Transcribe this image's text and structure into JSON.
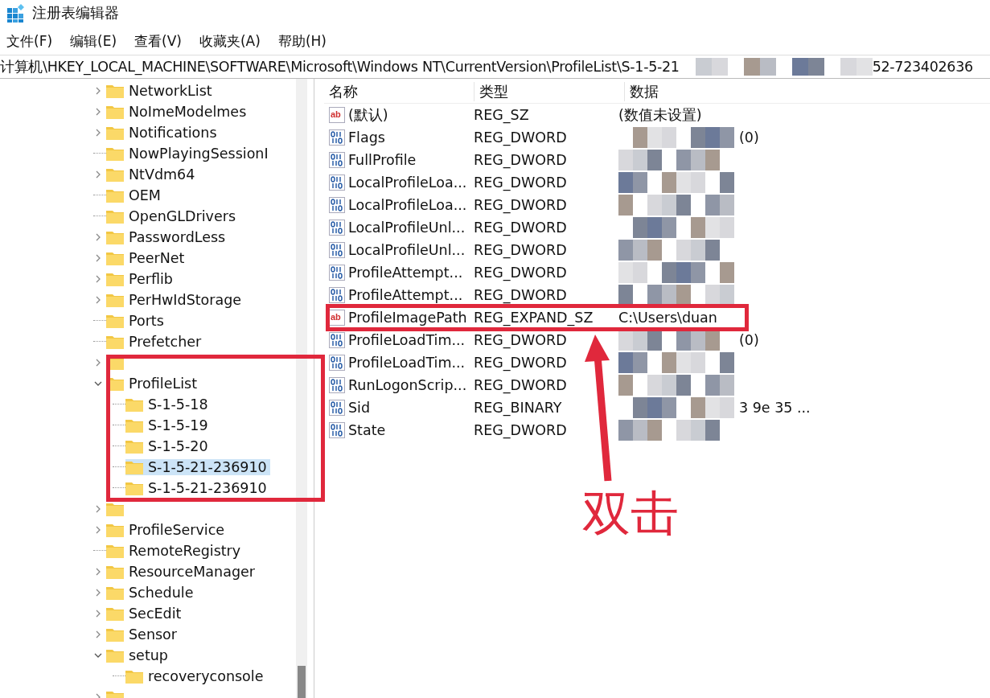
{
  "window": {
    "title": "注册表编辑器"
  },
  "menu": [
    "文件(F)",
    "编辑(E)",
    "查看(V)",
    "收藏夹(A)",
    "帮助(H)"
  ],
  "address": {
    "start": "计算机\\HKEY_LOCAL_MACHINE\\SOFTWARE\\Microsoft\\Windows NT\\CurrentVersion\\ProfileList\\S-1-5-21",
    "end": "52-723402636"
  },
  "tree": [
    {
      "label": "NetworkList",
      "kind": "branch",
      "expanded": false,
      "selected": false
    },
    {
      "label": "NoImeModelmes",
      "kind": "branch",
      "expanded": false,
      "selected": false
    },
    {
      "label": "Notifications",
      "kind": "branch",
      "expanded": false,
      "selected": false
    },
    {
      "label": "NowPlayingSessionI",
      "kind": "leaf",
      "selected": false
    },
    {
      "label": "NtVdm64",
      "kind": "branch",
      "expanded": false,
      "selected": false
    },
    {
      "label": "OEM",
      "kind": "leaf",
      "selected": false
    },
    {
      "label": "OpenGLDrivers",
      "kind": "leaf",
      "selected": false
    },
    {
      "label": "PasswordLess",
      "kind": "branch",
      "expanded": false,
      "selected": false
    },
    {
      "label": "PeerNet",
      "kind": "branch",
      "expanded": false,
      "selected": false
    },
    {
      "label": "Perflib",
      "kind": "branch",
      "expanded": false,
      "selected": false
    },
    {
      "label": "PerHwIdStorage",
      "kind": "branch",
      "expanded": false,
      "selected": false
    },
    {
      "label": "Ports",
      "kind": "leaf",
      "selected": false
    },
    {
      "label": "Prefetcher",
      "kind": "leaf",
      "selected": false
    },
    {
      "kind": "branch",
      "expanded": false,
      "selected": false
    },
    {
      "label": "ProfileList",
      "kind": "branch",
      "expanded": true,
      "selected": false,
      "children": [
        {
          "label": "S-1-5-18",
          "kind": "leaf",
          "selected": false
        },
        {
          "label": "S-1-5-19",
          "kind": "leaf",
          "selected": false
        },
        {
          "label": "S-1-5-20",
          "kind": "leaf",
          "selected": false
        },
        {
          "label": "S-1-5-21-236910",
          "kind": "leaf",
          "selected": true
        },
        {
          "label": "S-1-5-21-236910",
          "kind": "leaf",
          "selected": false
        }
      ]
    },
    {
      "kind": "branch",
      "expanded": false,
      "selected": false
    },
    {
      "label": "ProfileService",
      "kind": "branch",
      "expanded": false,
      "selected": false
    },
    {
      "label": "RemoteRegistry",
      "kind": "leaf",
      "selected": false
    },
    {
      "label": "ResourceManager",
      "kind": "branch",
      "expanded": false,
      "selected": false
    },
    {
      "label": "Schedule",
      "kind": "branch",
      "expanded": false,
      "selected": false
    },
    {
      "label": "SecEdit",
      "kind": "branch",
      "expanded": false,
      "selected": false
    },
    {
      "label": "Sensor",
      "kind": "branch",
      "expanded": false,
      "selected": false
    },
    {
      "label": "setup",
      "kind": "branch",
      "expanded": true,
      "selected": false,
      "children": [
        {
          "label": "recoveryconsole",
          "kind": "leaf",
          "selected": false
        }
      ]
    },
    {
      "kind": "branch",
      "expanded": false,
      "selected": false
    }
  ],
  "values": {
    "columns": [
      "名称",
      "类型",
      "数据"
    ],
    "rows": [
      {
        "name": "(默认)",
        "kind": "string",
        "icon": "ab",
        "type": "REG_SZ",
        "data": "(数值未设置)",
        "redacted": false
      },
      {
        "name": "Flags",
        "kind": "binary",
        "type": "REG_DWORD",
        "data": "(0)",
        "redacted": true
      },
      {
        "name": "FullProfile",
        "kind": "binary",
        "type": "REG_DWORD",
        "redacted": true
      },
      {
        "name": "LocalProfileLoa...",
        "kind": "binary",
        "type": "REG_DWORD",
        "redacted": true
      },
      {
        "name": "LocalProfileLoa...",
        "kind": "binary",
        "type": "REG_DWORD",
        "redacted": true
      },
      {
        "name": "LocalProfileUnl...",
        "kind": "binary",
        "type": "REG_DWORD",
        "redacted": true
      },
      {
        "name": "LocalProfileUnl...",
        "kind": "binary",
        "type": "REG_DWORD",
        "redacted": true
      },
      {
        "name": "ProfileAttempt...",
        "kind": "binary",
        "type": "REG_DWORD",
        "redacted": true
      },
      {
        "name": "ProfileAttempt...",
        "kind": "binary",
        "type": "REG_DWORD",
        "redacted": true
      },
      {
        "name": "ProfileImagePath",
        "kind": "string",
        "icon": "ab",
        "type": "REG_EXPAND_SZ",
        "data": "C:\\Users\\duan",
        "redacted": false
      },
      {
        "name": "ProfileLoadTim...",
        "kind": "binary",
        "type": "REG_DWORD",
        "data": "(0)",
        "redacted": true
      },
      {
        "name": "ProfileLoadTim...",
        "kind": "binary",
        "type": "REG_DWORD",
        "redacted": true
      },
      {
        "name": "RunLogonScrip...",
        "kind": "binary",
        "type": "REG_DWORD",
        "redacted": true
      },
      {
        "name": "Sid",
        "kind": "binary",
        "type": "REG_BINARY",
        "data": "3 9e 35 ...",
        "redacted": true
      },
      {
        "name": "State",
        "kind": "binary",
        "type": "REG_DWORD",
        "redacted": true
      }
    ]
  },
  "annotation": {
    "label": "双击"
  }
}
